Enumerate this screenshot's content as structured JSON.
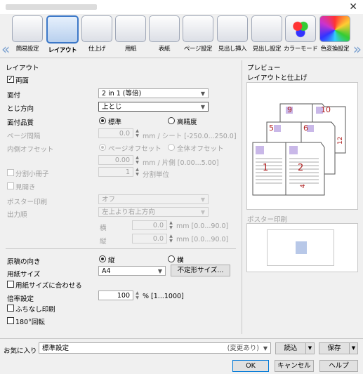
{
  "window": {
    "close_glyph": "✕"
  },
  "tabs": [
    {
      "label": "簡易設定",
      "icon": "quick-settings-icon"
    },
    {
      "label": "レイアウト",
      "icon": "layout-icon",
      "active": true
    },
    {
      "label": "仕上げ",
      "icon": "finishing-icon"
    },
    {
      "label": "用紙",
      "icon": "paper-icon"
    },
    {
      "label": "表紙",
      "icon": "cover-icon"
    },
    {
      "label": "ページ設定",
      "icon": "page-setup-icon"
    },
    {
      "label": "見出し挿入",
      "icon": "tab-insert-icon"
    },
    {
      "label": "見出し設定",
      "icon": "tab-settings-icon"
    },
    {
      "label": "カラーモード",
      "icon": "color-mode-icon"
    },
    {
      "label": "色変換設定",
      "icon": "color-conversion-icon"
    }
  ],
  "layout": {
    "section": "レイアウト",
    "duplex_label": "両面",
    "pages_per_sheet_label": "面付",
    "pages_per_sheet_value": "2 in 1 (等倍)",
    "binding_label": "とじ方向",
    "binding_value": "上とじ",
    "quality_label": "面付品質",
    "quality_standard": "標準",
    "quality_high": "高精度",
    "page_spacing_label": "ページ間隔",
    "page_spacing_value": "0.0",
    "page_spacing_unit": "mm / シート [-250.0...250.0]",
    "inner_offset_label": "内側オフセット",
    "page_offset": "ページオフセット",
    "whole_offset": "全体オフセット",
    "offset_value": "0.00",
    "offset_unit": "mm / 片側 [0.00...5.00]",
    "split_booklet_label": "分割小冊子",
    "split_value": "1",
    "split_unit": "分割単位",
    "spread_label": "見開き",
    "poster_label": "ポスター印刷",
    "poster_value": "オフ",
    "output_order_label": "出力順",
    "output_order_value": "左上より右上方向",
    "h_label": "横",
    "h_value": "0.0",
    "v_label": "縦",
    "v_value": "0.0",
    "margin_unit": "mm [0.0...90.0]"
  },
  "document": {
    "orientation_label": "原稿の向き",
    "portrait": "縦",
    "landscape": "横",
    "paper_size_label": "用紙サイズ",
    "paper_size_value": "A4",
    "custom_size_button": "不定形サイズ...",
    "fit_paper_label": "用紙サイズに合わせる",
    "zoom_label": "倍率設定",
    "zoom_value": "100",
    "zoom_unit": "% [1...1000]",
    "borderless_label": "ふちなし印刷",
    "rotate_label": "180°回転"
  },
  "preview": {
    "title": "プレビュー",
    "subtitle": "レイアウトと仕上げ",
    "poster_title": "ポスター印刷",
    "page_numbers": [
      "9",
      "10",
      "5",
      "6",
      "1",
      "2",
      "12",
      "4"
    ]
  },
  "footer": {
    "favorites_label": "お気に入り",
    "favorites_value": "標準設定",
    "favorites_note": "(変更あり)",
    "load_button": "読込",
    "save_button": "保存",
    "ok": "OK",
    "cancel": "キャンセル",
    "help": "ヘルプ"
  }
}
